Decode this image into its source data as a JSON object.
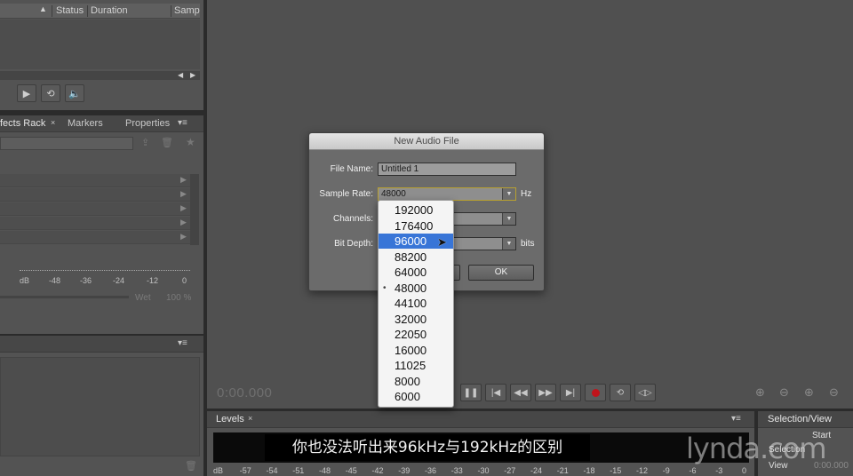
{
  "files_panel": {
    "columns": [
      "Status",
      "Duration",
      "Samp"
    ]
  },
  "effects_panel": {
    "tabs": [
      "fects Rack",
      "Markers",
      "Properties"
    ],
    "ruler": [
      "dB",
      "-48",
      "-36",
      "-24",
      "-12",
      "0"
    ],
    "wet_label": "Wet",
    "wet_value": "100 %"
  },
  "editor": {
    "time": "0:00.000"
  },
  "levels": {
    "tab": "Levels",
    "scale": [
      "dB",
      "-57",
      "-54",
      "-51",
      "-48",
      "-45",
      "-42",
      "-39",
      "-36",
      "-33",
      "-30",
      "-27",
      "-24",
      "-21",
      "-18",
      "-15",
      "-12",
      "-9",
      "-6",
      "-3",
      "0"
    ]
  },
  "selection_view": {
    "title": "Selection/View",
    "start_label": "Start",
    "selection_label": "Selection",
    "view_label": "View",
    "view_value": "0:00.000"
  },
  "dialog": {
    "title": "New Audio File",
    "file_name_label": "File Name:",
    "file_name_value": "Untitled 1",
    "sample_rate_label": "Sample Rate:",
    "sample_rate_value": "48000",
    "sample_rate_unit": "Hz",
    "channels_label": "Channels:",
    "bit_depth_label": "Bit Depth:",
    "bit_depth_unit": "bits",
    "ok_label": "OK"
  },
  "dropdown": {
    "options": [
      "192000",
      "176400",
      "96000",
      "88200",
      "64000",
      "48000",
      "44100",
      "32000",
      "22050",
      "16000",
      "11025",
      "8000",
      "6000"
    ],
    "highlighted": "96000",
    "checked": "48000"
  },
  "subtitle": "你也没法听出来96kHz与192kHz的区别",
  "watermark": "lynda.com"
}
